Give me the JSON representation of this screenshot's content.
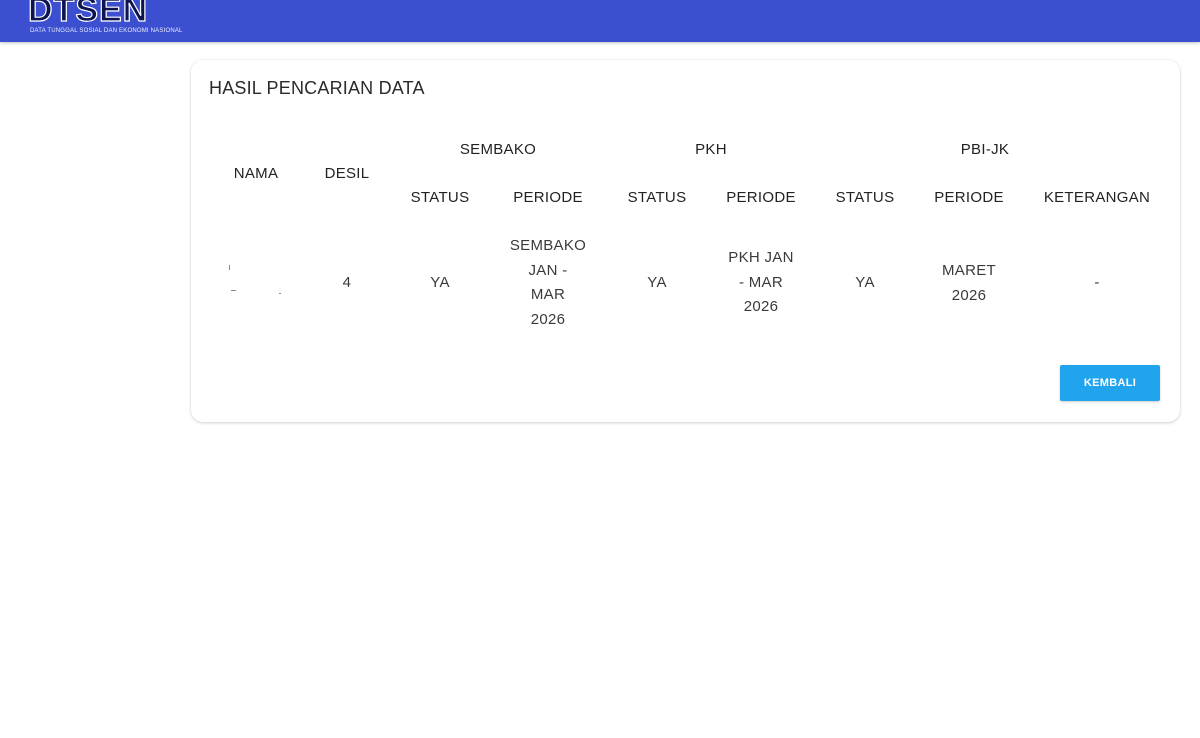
{
  "header": {
    "logo_text": "DTSEN",
    "tagline": "DATA TUNGGAL SOSIAL DAN EKONOMI NASIONAL"
  },
  "card": {
    "title": "HASIL PENCARIAN DATA",
    "columns": {
      "nama": "NAMA",
      "desil": "DESIL",
      "sembako": "SEMBAKO",
      "pkh": "PKH",
      "pbi_jk": "PBI-JK",
      "status": "STATUS",
      "periode": "PERIODE",
      "keterangan": "KETERANGAN"
    },
    "row": {
      "desil": "4",
      "sembako_status": "YA",
      "sembako_periode_lines": [
        "SEMBAKO",
        "JAN -",
        "MAR",
        "2026"
      ],
      "pkh_status": "YA",
      "pkh_periode_lines": [
        "PKH JAN",
        "- MAR",
        "2026"
      ],
      "pbi_status": "YA",
      "pbi_periode_lines": [
        "MARET",
        "2026"
      ],
      "keterangan": "-"
    },
    "back_button": "KEMBALI"
  }
}
